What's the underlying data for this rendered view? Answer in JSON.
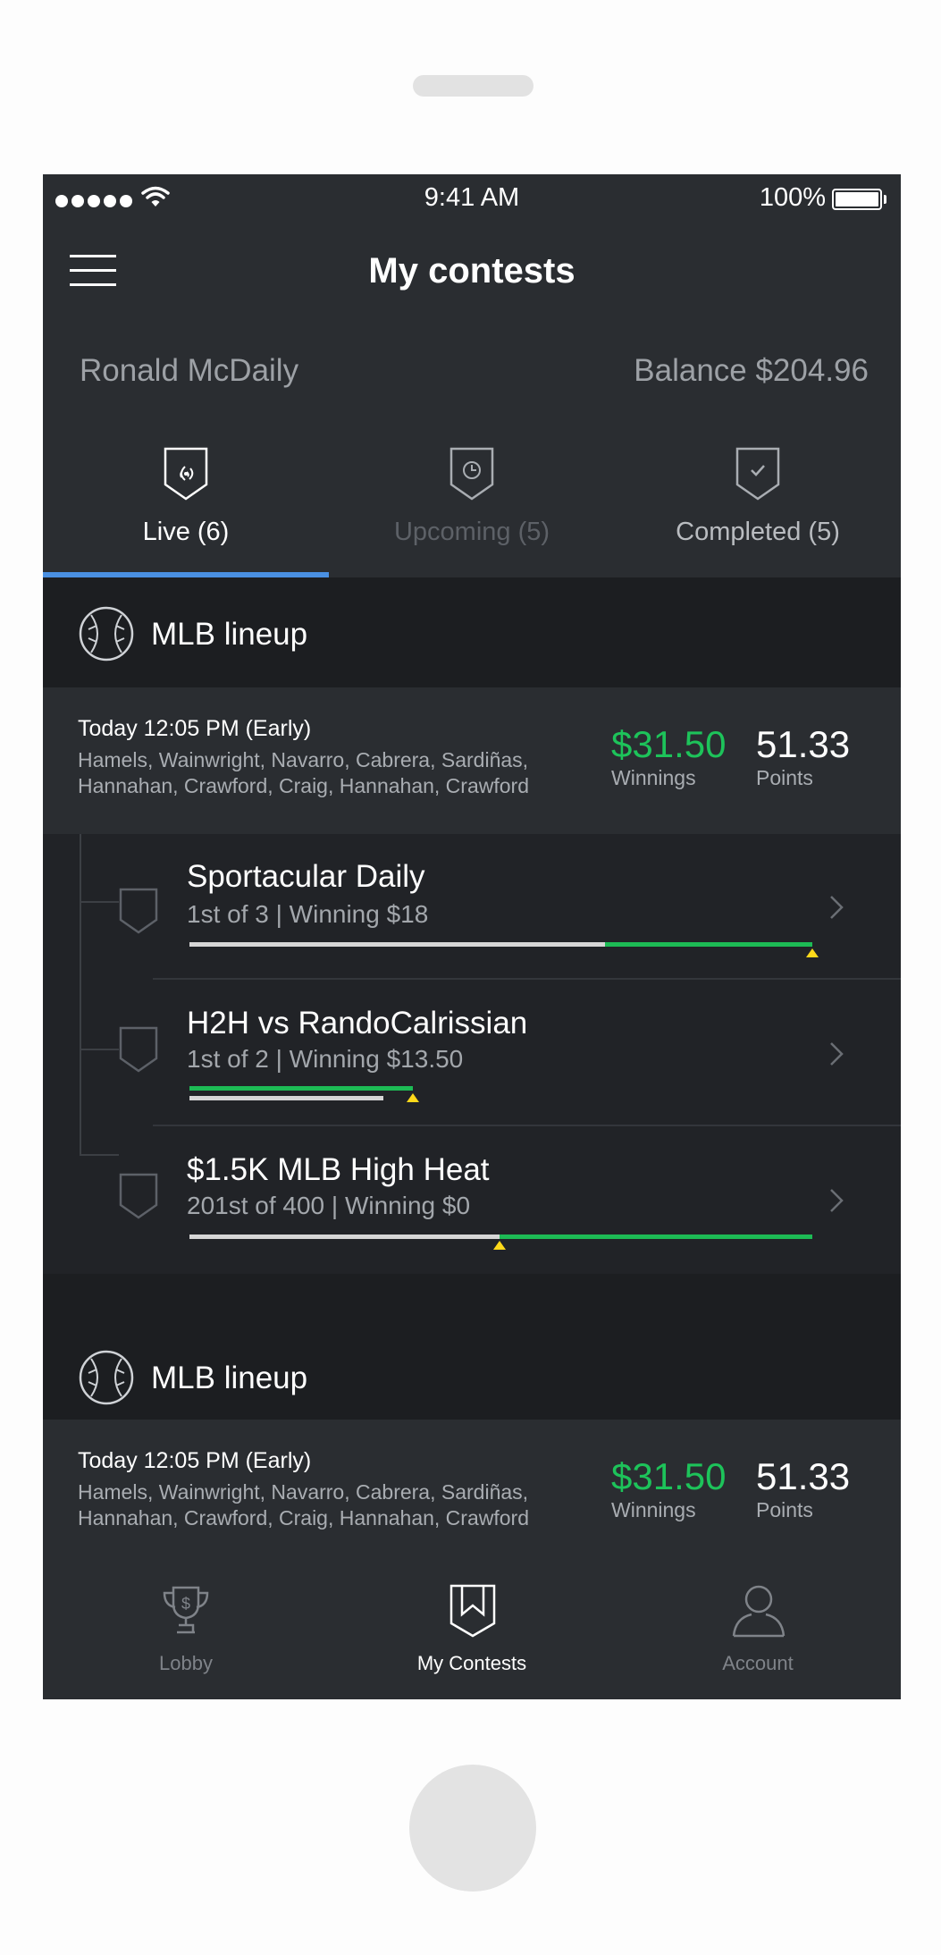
{
  "status_bar": {
    "time": "9:41 AM",
    "battery": "100%"
  },
  "header": {
    "title": "My contests"
  },
  "user": {
    "name": "Ronald McDaily",
    "balance": "Balance $204.96"
  },
  "tabs": [
    {
      "label": "Live (6)",
      "icon": "live-shield-icon",
      "active": true
    },
    {
      "label": "Upcoming (5)",
      "icon": "clock-shield-icon",
      "active": false
    },
    {
      "label": "Completed (5)",
      "icon": "check-shield-icon",
      "active": false
    }
  ],
  "sections": [
    {
      "title": "MLB lineup",
      "icon": "baseball-icon",
      "time": "Today 12:05 PM (Early)",
      "players_line1": "Hamels, Wainwright, Navarro, Cabrera, Sardiñas,",
      "players_line2": "Hannahan, Crawford, Craig, Hannahan, Crawford",
      "winnings": "$31.50",
      "winnings_label": "Winnings",
      "points": "51.33",
      "points_label": "Points",
      "contests": [
        {
          "title": "Sportacular Daily",
          "subtitle": "1st of 3 | Winning $18",
          "progress": 0.67
        },
        {
          "title": "H2H vs RandoCalrissian",
          "subtitle": "1st of 2 | Winning $13.50",
          "progress": 0.36
        },
        {
          "title": "$1.5K MLB High Heat",
          "subtitle": "201st of 400 | Winning $0",
          "progress": 0.5
        }
      ]
    },
    {
      "title": "MLB lineup",
      "icon": "baseball-icon",
      "time": "Today 12:05 PM (Early)",
      "players_line1": "Hamels, Wainwright, Navarro, Cabrera, Sardiñas,",
      "players_line2": "Hannahan, Crawford, Craig, Hannahan, Crawford",
      "winnings": "$31.50",
      "winnings_label": "Winnings",
      "points": "51.33",
      "points_label": "Points"
    }
  ],
  "tab_bar": [
    {
      "label": "Lobby",
      "icon": "trophy-icon",
      "active": false
    },
    {
      "label": "My Contests",
      "icon": "bookmark-shield-icon",
      "active": true
    },
    {
      "label": "Account",
      "icon": "person-icon",
      "active": false
    }
  ],
  "colors": {
    "background": "#2a2d31",
    "accent_blue": "#4a90e2",
    "winnings_green": "#1dc35a",
    "marker_yellow": "#ffd91a"
  }
}
